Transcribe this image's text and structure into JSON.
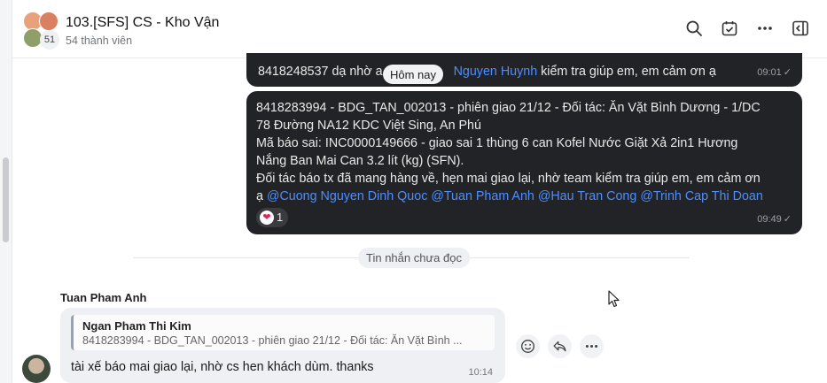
{
  "group": {
    "title": "103.[SFS] CS - Kho Vận",
    "members": "54 thành viên",
    "avatar_count": "51"
  },
  "dividers": {
    "today": "Hôm nay",
    "unread": "Tin nhắn chưa đọc"
  },
  "messages": {
    "m1": {
      "before": "8418248537 dạ nhờ a",
      "mention": "Nguyen Huynh",
      "after": " kiểm  tra giúp em, em cảm ơn ạ",
      "time": "09:01"
    },
    "m2": {
      "line1": "8418283994 - BDG_TAN_002013  - phiên giao 21/12 -  Đối tác: Ăn Vặt Bình Dương - 1/DC",
      "line2": "78 Đường NA12 KDC Việt Sing, An Phú",
      "line3": "Mã báo sai: INC0000149666  - giao sai  1 thùng 6 can Kofel Nước Giặt Xả 2in1 Hương",
      "line4": "Nắng Ban Mai Can 3.2 lít (kg) (SFN).",
      "line5": "Đối tác báo tx đã mang hàng về, hẹn mai giao lại, nhờ team kiểm tra giúp em, em cảm ơn",
      "line6_prefix": "ạ ",
      "mentions": [
        "@Cuong Nguyen Dinh Quoc",
        "@Tuan Pham Anh",
        "@Hau Tran Cong",
        "@Trinh Cap Thi Doan"
      ],
      "reaction_count": "1",
      "time": "09:49"
    },
    "m3": {
      "sender": "Tuan Pham Anh",
      "quote_name": "Ngan Pham Thi Kim",
      "quote_text": "8418283994 - BDG_TAN_002013 - phiên giao 21/12 - Đối tác: Ăn Vặt Bình ...",
      "text": "tài xế báo mai giao lại, nhờ cs hen khách dùm.  thanks",
      "time": "10:14"
    }
  },
  "colors": {
    "dark_bubble": "#222326",
    "mention": "#4d8eff",
    "light_bubble": "#eef0f3"
  }
}
